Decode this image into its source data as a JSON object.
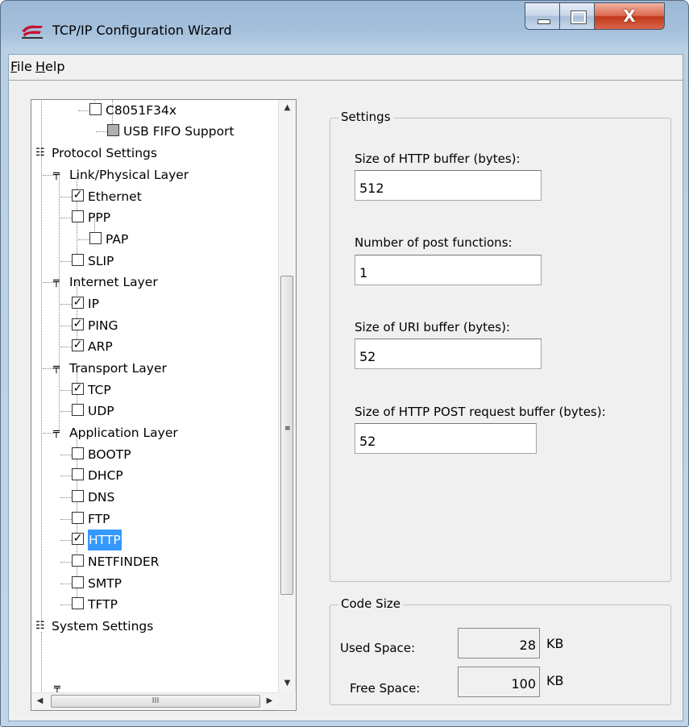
{
  "window": {
    "title": "TCP/IP Configuration Wizard",
    "controls": {
      "minimize": "–",
      "maximize": "□",
      "close": "X"
    }
  },
  "menu": {
    "file": {
      "accel": "F",
      "rest": "ile"
    },
    "help": {
      "accel": "H",
      "rest": "elp"
    }
  },
  "tree": {
    "nodes": [
      {
        "label": "C8051F34x",
        "checkbox": "unchecked"
      },
      {
        "label": "USB FIFO Support",
        "checkbox": "grey"
      },
      {
        "label": "Protocol Settings",
        "icon": "list-icon"
      },
      {
        "label": "Link/Physical Layer",
        "icon": "layer-icon"
      },
      {
        "label": "Ethernet",
        "checkbox": "checked"
      },
      {
        "label": "PPP",
        "checkbox": "unchecked"
      },
      {
        "label": "PAP",
        "checkbox": "unchecked"
      },
      {
        "label": "SLIP",
        "checkbox": "unchecked"
      },
      {
        "label": "Internet Layer",
        "icon": "layer-icon"
      },
      {
        "label": "IP",
        "checkbox": "checked"
      },
      {
        "label": "PING",
        "checkbox": "checked"
      },
      {
        "label": "ARP",
        "checkbox": "checked"
      },
      {
        "label": "Transport Layer",
        "icon": "layer-icon"
      },
      {
        "label": "TCP",
        "checkbox": "checked"
      },
      {
        "label": "UDP",
        "checkbox": "unchecked"
      },
      {
        "label": "Application Layer",
        "icon": "layer-icon"
      },
      {
        "label": "BOOTP",
        "checkbox": "unchecked"
      },
      {
        "label": "DHCP",
        "checkbox": "unchecked"
      },
      {
        "label": "DNS",
        "checkbox": "unchecked"
      },
      {
        "label": "FTP",
        "checkbox": "unchecked"
      },
      {
        "label": "HTTP",
        "checkbox": "checked",
        "selected": true
      },
      {
        "label": "NETFINDER",
        "checkbox": "unchecked"
      },
      {
        "label": "SMTP",
        "checkbox": "unchecked"
      },
      {
        "label": "TFTP",
        "checkbox": "unchecked"
      },
      {
        "label": "System Settings",
        "icon": "list-icon"
      }
    ]
  },
  "settings": {
    "title": "Settings",
    "fields": [
      {
        "label": "Size of HTTP buffer (bytes):",
        "value": "512"
      },
      {
        "label": "Number of post functions:",
        "value": "1"
      },
      {
        "label": "Size of URI buffer (bytes):",
        "value": "52"
      },
      {
        "label": "Size of HTTP POST request buffer (bytes):",
        "value": "52"
      }
    ]
  },
  "code_size": {
    "title": "Code Size",
    "used_label": "Used Space:",
    "used_value": "28",
    "free_label": "Free Space:",
    "free_value": "100",
    "unit": "KB"
  },
  "colors": {
    "selection": "#3399ff",
    "close_button": "#c2391b"
  }
}
